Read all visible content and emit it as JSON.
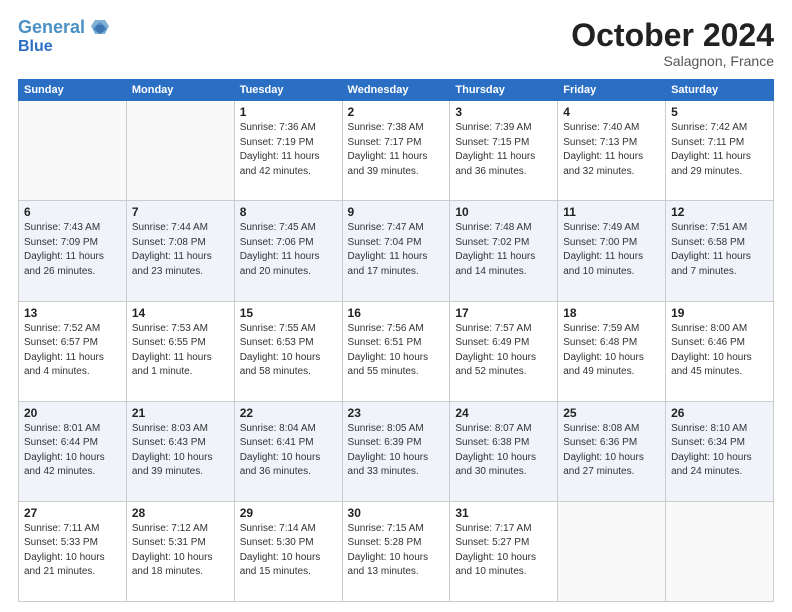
{
  "header": {
    "logo_line1": "General",
    "logo_line2": "Blue",
    "month": "October 2024",
    "location": "Salagnon, France"
  },
  "weekdays": [
    "Sunday",
    "Monday",
    "Tuesday",
    "Wednesday",
    "Thursday",
    "Friday",
    "Saturday"
  ],
  "weeks": [
    [
      {
        "day": "",
        "info": ""
      },
      {
        "day": "",
        "info": ""
      },
      {
        "day": "1",
        "info": "Sunrise: 7:36 AM\nSunset: 7:19 PM\nDaylight: 11 hours and 42 minutes."
      },
      {
        "day": "2",
        "info": "Sunrise: 7:38 AM\nSunset: 7:17 PM\nDaylight: 11 hours and 39 minutes."
      },
      {
        "day": "3",
        "info": "Sunrise: 7:39 AM\nSunset: 7:15 PM\nDaylight: 11 hours and 36 minutes."
      },
      {
        "day": "4",
        "info": "Sunrise: 7:40 AM\nSunset: 7:13 PM\nDaylight: 11 hours and 32 minutes."
      },
      {
        "day": "5",
        "info": "Sunrise: 7:42 AM\nSunset: 7:11 PM\nDaylight: 11 hours and 29 minutes."
      }
    ],
    [
      {
        "day": "6",
        "info": "Sunrise: 7:43 AM\nSunset: 7:09 PM\nDaylight: 11 hours and 26 minutes."
      },
      {
        "day": "7",
        "info": "Sunrise: 7:44 AM\nSunset: 7:08 PM\nDaylight: 11 hours and 23 minutes."
      },
      {
        "day": "8",
        "info": "Sunrise: 7:45 AM\nSunset: 7:06 PM\nDaylight: 11 hours and 20 minutes."
      },
      {
        "day": "9",
        "info": "Sunrise: 7:47 AM\nSunset: 7:04 PM\nDaylight: 11 hours and 17 minutes."
      },
      {
        "day": "10",
        "info": "Sunrise: 7:48 AM\nSunset: 7:02 PM\nDaylight: 11 hours and 14 minutes."
      },
      {
        "day": "11",
        "info": "Sunrise: 7:49 AM\nSunset: 7:00 PM\nDaylight: 11 hours and 10 minutes."
      },
      {
        "day": "12",
        "info": "Sunrise: 7:51 AM\nSunset: 6:58 PM\nDaylight: 11 hours and 7 minutes."
      }
    ],
    [
      {
        "day": "13",
        "info": "Sunrise: 7:52 AM\nSunset: 6:57 PM\nDaylight: 11 hours and 4 minutes."
      },
      {
        "day": "14",
        "info": "Sunrise: 7:53 AM\nSunset: 6:55 PM\nDaylight: 11 hours and 1 minute."
      },
      {
        "day": "15",
        "info": "Sunrise: 7:55 AM\nSunset: 6:53 PM\nDaylight: 10 hours and 58 minutes."
      },
      {
        "day": "16",
        "info": "Sunrise: 7:56 AM\nSunset: 6:51 PM\nDaylight: 10 hours and 55 minutes."
      },
      {
        "day": "17",
        "info": "Sunrise: 7:57 AM\nSunset: 6:49 PM\nDaylight: 10 hours and 52 minutes."
      },
      {
        "day": "18",
        "info": "Sunrise: 7:59 AM\nSunset: 6:48 PM\nDaylight: 10 hours and 49 minutes."
      },
      {
        "day": "19",
        "info": "Sunrise: 8:00 AM\nSunset: 6:46 PM\nDaylight: 10 hours and 45 minutes."
      }
    ],
    [
      {
        "day": "20",
        "info": "Sunrise: 8:01 AM\nSunset: 6:44 PM\nDaylight: 10 hours and 42 minutes."
      },
      {
        "day": "21",
        "info": "Sunrise: 8:03 AM\nSunset: 6:43 PM\nDaylight: 10 hours and 39 minutes."
      },
      {
        "day": "22",
        "info": "Sunrise: 8:04 AM\nSunset: 6:41 PM\nDaylight: 10 hours and 36 minutes."
      },
      {
        "day": "23",
        "info": "Sunrise: 8:05 AM\nSunset: 6:39 PM\nDaylight: 10 hours and 33 minutes."
      },
      {
        "day": "24",
        "info": "Sunrise: 8:07 AM\nSunset: 6:38 PM\nDaylight: 10 hours and 30 minutes."
      },
      {
        "day": "25",
        "info": "Sunrise: 8:08 AM\nSunset: 6:36 PM\nDaylight: 10 hours and 27 minutes."
      },
      {
        "day": "26",
        "info": "Sunrise: 8:10 AM\nSunset: 6:34 PM\nDaylight: 10 hours and 24 minutes."
      }
    ],
    [
      {
        "day": "27",
        "info": "Sunrise: 7:11 AM\nSunset: 5:33 PM\nDaylight: 10 hours and 21 minutes."
      },
      {
        "day": "28",
        "info": "Sunrise: 7:12 AM\nSunset: 5:31 PM\nDaylight: 10 hours and 18 minutes."
      },
      {
        "day": "29",
        "info": "Sunrise: 7:14 AM\nSunset: 5:30 PM\nDaylight: 10 hours and 15 minutes."
      },
      {
        "day": "30",
        "info": "Sunrise: 7:15 AM\nSunset: 5:28 PM\nDaylight: 10 hours and 13 minutes."
      },
      {
        "day": "31",
        "info": "Sunrise: 7:17 AM\nSunset: 5:27 PM\nDaylight: 10 hours and 10 minutes."
      },
      {
        "day": "",
        "info": ""
      },
      {
        "day": "",
        "info": ""
      }
    ]
  ]
}
